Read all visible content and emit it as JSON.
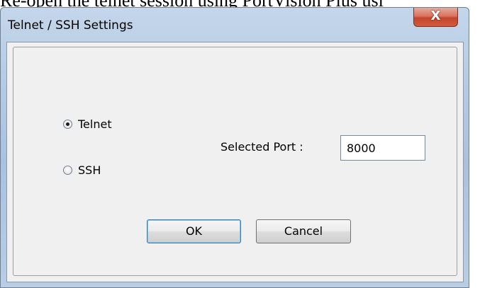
{
  "document": {
    "text": "Re-open the telnet session using PortVision Plus usi"
  },
  "window": {
    "title": "Telnet / SSH Settings",
    "close_glyph": "X"
  },
  "protocol": {
    "options": [
      {
        "label": "Telnet",
        "selected": true
      },
      {
        "label": "SSH",
        "selected": false
      }
    ]
  },
  "port": {
    "label": "Selected Port :",
    "value": "8000"
  },
  "buttons": {
    "ok": "OK",
    "cancel": "Cancel"
  }
}
